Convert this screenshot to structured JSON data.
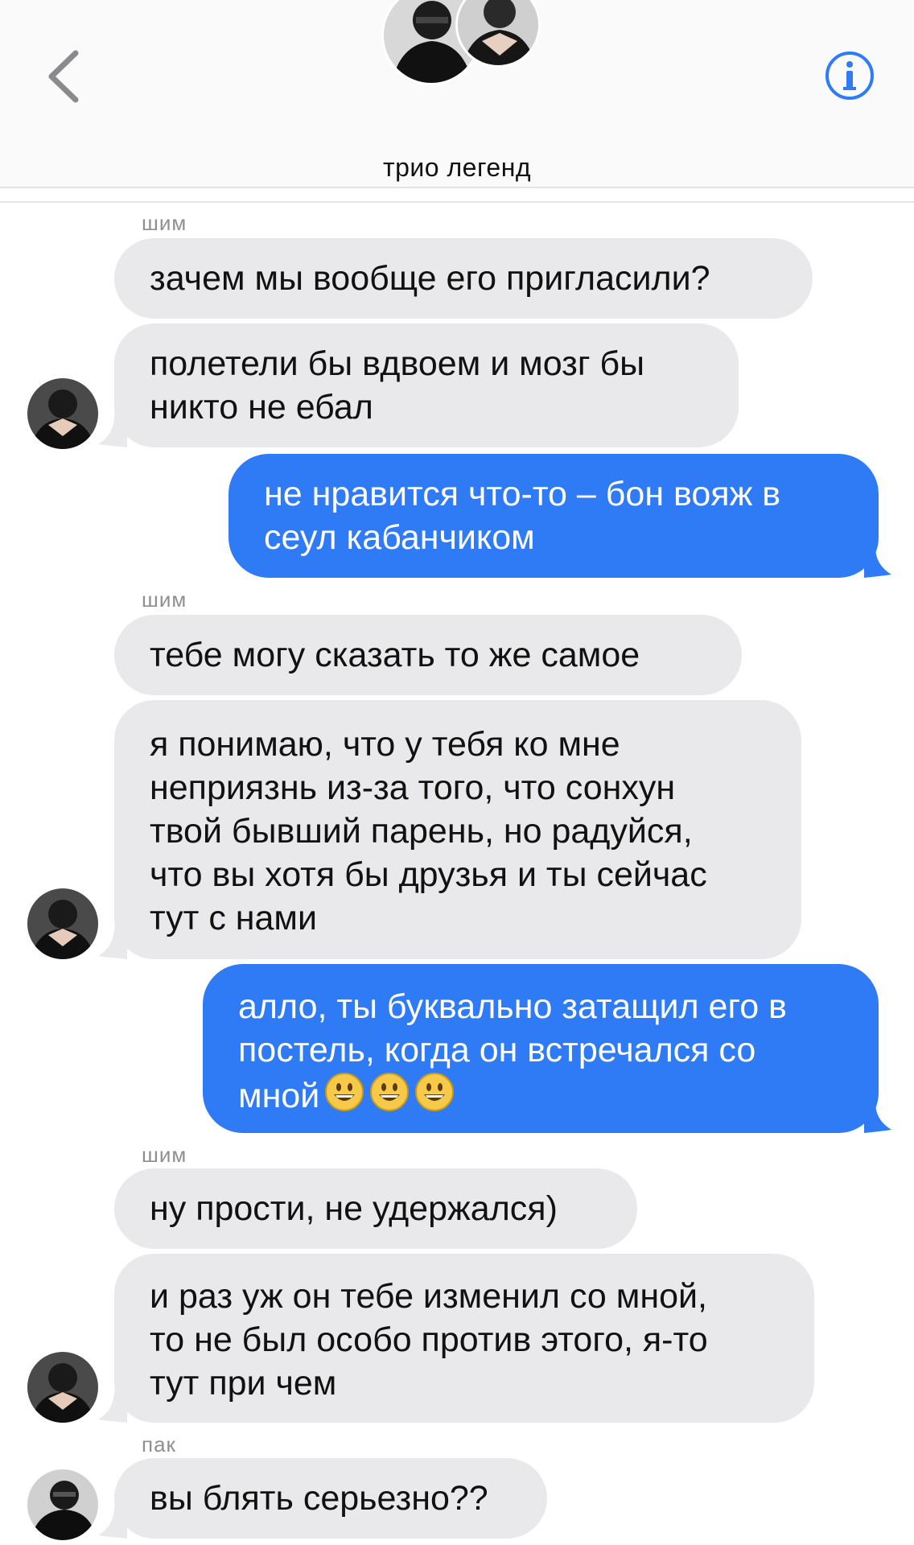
{
  "header": {
    "title": "трио легенд",
    "back_icon": "chevron-left-icon",
    "info_icon": "info-icon"
  },
  "colors": {
    "accent": "#2f7bf5",
    "incoming_bubble": "#e9e9eb",
    "sender_label": "#8e8e93"
  },
  "messages": [
    {
      "sender": "шим",
      "text": "зачем мы вообще его пригласили?"
    },
    {
      "text": "полетели бы вдвоем и мозг бы\nникто не ебал"
    },
    {
      "text": "не нравится что-то – бон вояж в\nсеул кабанчиком"
    },
    {
      "sender": "шим",
      "text": "тебе могу сказать то же самое"
    },
    {
      "text": "я понимаю, что у тебя ко мне\nнеприязнь из-за того, что сонхун\nтвой бывший парень, но радуйся,\nчто вы хотя бы друзья и ты сейчас\nтут с нами"
    },
    {
      "text": "алло, ты буквально затащил его в\nпостель, когда он встречался со\nмной",
      "emoji": "grinning-face-emoji"
    },
    {
      "sender": "шим",
      "text": "ну прости, не удержался)"
    },
    {
      "text": "и раз уж он тебе изменил со мной,\nто не был особо против этого, я-то\nтут при чем"
    },
    {
      "sender": "пак",
      "text": "вы блять серьезно??"
    }
  ]
}
